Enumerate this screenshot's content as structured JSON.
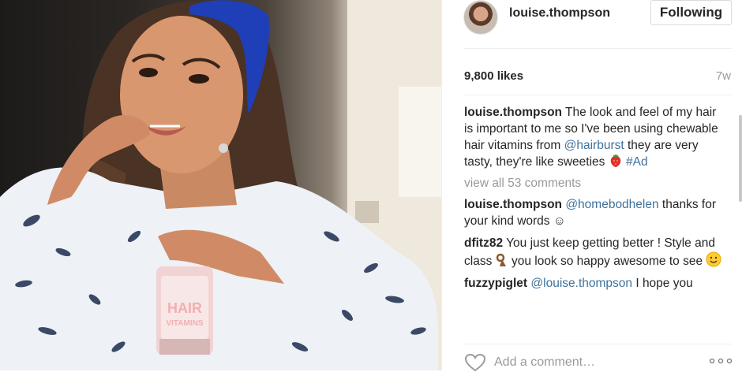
{
  "post": {
    "username": "louise.thompson",
    "follow_label": "Following",
    "likes": "9,800 likes",
    "time_ago": "7w",
    "view_all": "view all 53 comments",
    "add_comment_placeholder": "Add a comment…"
  },
  "caption": {
    "author": "louise.thompson",
    "text1": "The look and feel of my hair is important to me so I've been using chewable hair vitamins from",
    "mention": "@hairburst",
    "text2": "they are very tasty, they're like sweeties",
    "hashtag": "#Ad",
    "emoji": "strawberry"
  },
  "comments": [
    {
      "author": "louise.thompson",
      "mention": "@homebodhelen",
      "text": "thanks for your kind words ☺"
    },
    {
      "author": "dfitz82",
      "text1": "You just keep getting better ! Style and class",
      "text2": "you look so happy awesome to see"
    },
    {
      "author": "fuzzypiglet",
      "mention": "@louise.thompson",
      "text": "I hope you"
    }
  ],
  "photo": {
    "product_label_line1": "HAIR",
    "product_label_line2": "VITAMINS"
  },
  "colors": {
    "link": "#3f729b",
    "muted": "#999999",
    "text": "#262626",
    "headband": "#1f3fb8"
  }
}
